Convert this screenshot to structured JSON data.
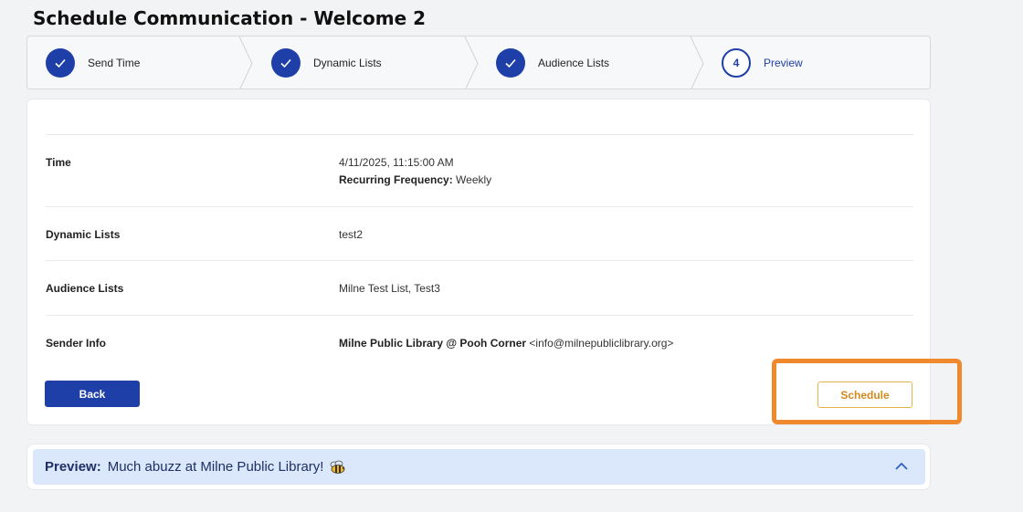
{
  "page": {
    "title": "Schedule Communication - Welcome 2"
  },
  "stepper": {
    "steps": [
      {
        "label": "Send Time",
        "status": "done",
        "icon": "check-icon"
      },
      {
        "label": "Dynamic Lists",
        "status": "done",
        "icon": "check-icon"
      },
      {
        "label": "Audience Lists",
        "status": "done",
        "icon": "check-icon"
      },
      {
        "label": "Preview",
        "status": "current",
        "number": "4"
      }
    ]
  },
  "summary": {
    "time": {
      "key": "Time",
      "value": "4/11/2025, 11:15:00 AM",
      "recurring_label": "Recurring Frequency:",
      "recurring_value": "Weekly"
    },
    "dynamic_lists": {
      "key": "Dynamic Lists",
      "value": "test2"
    },
    "audience_lists": {
      "key": "Audience Lists",
      "value": "Milne Test List, Test3"
    },
    "sender_info": {
      "key": "Sender Info",
      "name": "Milne Public Library @ Pooh Corner",
      "email": "<info@milnepubliclibrary.org>"
    }
  },
  "actions": {
    "back_label": "Back",
    "schedule_label": "Schedule"
  },
  "preview": {
    "label": "Preview:",
    "subject": "Much abuzz at Milne Public Library!",
    "emoji_icon": "bee-icon",
    "toggle_icon": "chevron-up-icon"
  },
  "colors": {
    "primary": "#1e3fa8",
    "schedule_text": "#d28a1f",
    "highlight": "#f0892e",
    "preview_bg": "#dbe8fb"
  }
}
